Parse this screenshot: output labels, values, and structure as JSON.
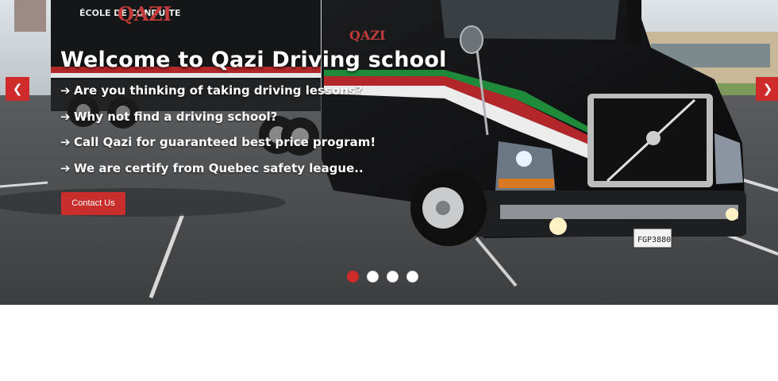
{
  "slider": {
    "title": "Welcome to Qazi Driving school",
    "bullets": [
      "Are you thinking of taking driving lessons?",
      "Why not find a driving school?",
      "Call Qazi for guaranteed best price program!",
      "We are certify from Quebec safety league.."
    ],
    "bullet_icon": "arrow-right-icon",
    "contact_label": "Contact Us",
    "prev_icon": "chevron-left-icon",
    "next_icon": "chevron-right-icon",
    "indicators": [
      {
        "label": "slide-1",
        "active": true
      },
      {
        "label": "slide-2",
        "active": false
      },
      {
        "label": "slide-3",
        "active": false
      },
      {
        "label": "slide-4",
        "active": false
      }
    ],
    "accent_color": "#cf2b2b"
  },
  "photo": {
    "trailer_text": "ÉCOLE DE CONDUITE",
    "brand_text": "QAZI",
    "plate": "FGP3880"
  }
}
